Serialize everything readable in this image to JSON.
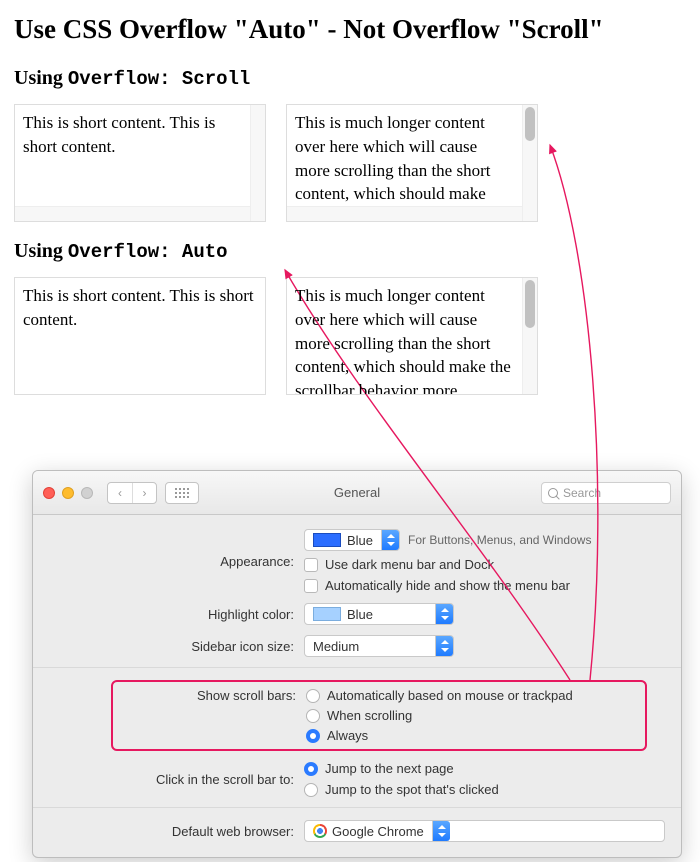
{
  "title": "Use CSS Overflow \"Auto\" - Not Overflow \"Scroll\"",
  "section1": {
    "heading_prefix": "Using ",
    "heading_code": "Overflow: Scroll",
    "box_left": "This is short content. This is short content.",
    "box_right": "This is much longer content over here which will cause more scrolling than the short content, which should make"
  },
  "section2": {
    "heading_prefix": "Using ",
    "heading_code": "Overflow: Auto",
    "box_left": "This is short content. This is short content.",
    "box_right": "This is much longer content over here which will cause more scrolling than the short content, which should make the scrollbar behavior more"
  },
  "prefs": {
    "title": "General",
    "search_placeholder": "Search",
    "appearance": {
      "label": "Appearance:",
      "value": "Blue",
      "hint": "For Buttons, Menus, and Windows"
    },
    "dark_menu": "Use dark menu bar and Dock",
    "auto_hide": "Automatically hide and show the menu bar",
    "highlight": {
      "label": "Highlight color:",
      "value": "Blue"
    },
    "sidebar": {
      "label": "Sidebar icon size:",
      "value": "Medium"
    },
    "scrollbars": {
      "label": "Show scroll bars:",
      "options": [
        "Automatically based on mouse or trackpad",
        "When scrolling",
        "Always"
      ],
      "selected_index": 2
    },
    "click_scroll": {
      "label": "Click in the scroll bar to:",
      "options": [
        "Jump to the next page",
        "Jump to the spot that's clicked"
      ],
      "selected_index": 0
    },
    "browser": {
      "label": "Default web browser:",
      "value": "Google Chrome"
    }
  },
  "annotation_color": "#e6185f"
}
